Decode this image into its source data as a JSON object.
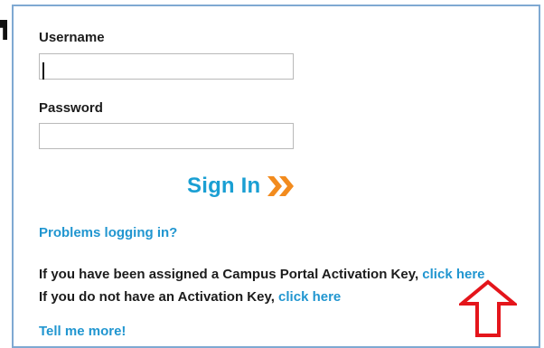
{
  "login": {
    "username_label": "Username",
    "username_value": "",
    "password_label": "Password",
    "password_value": "",
    "signin_label": "Sign In",
    "problems_link": "Problems logging in?"
  },
  "activation": {
    "assigned_text": "If you have been assigned a Campus Portal Activation Key, ",
    "assigned_link": "click here",
    "no_key_text": "If you do not have an Activation Key, ",
    "no_key_link": "click here"
  },
  "more": {
    "tell_me_more": "Tell me more!"
  },
  "colors": {
    "link": "#2196d0",
    "signin": "#1a9fd3",
    "signin_arrow": "#f28b1e",
    "annotation_arrow": "#e4151b",
    "panel_border": "#7fa9d2"
  },
  "icons": {
    "signin": "double-chevron-right-icon",
    "annotation": "up-arrow-icon"
  }
}
